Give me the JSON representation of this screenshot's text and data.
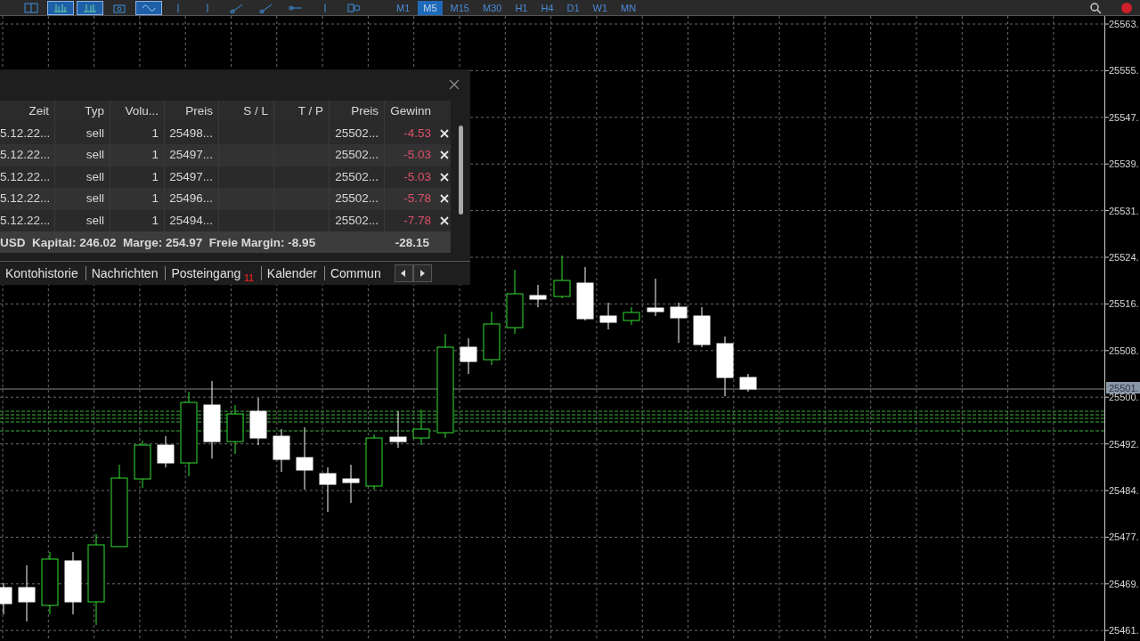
{
  "toolbar": {
    "tools": [
      {
        "kind": "layout",
        "selected": false
      },
      {
        "kind": "bars",
        "selected": true
      },
      {
        "kind": "candles",
        "selected": true
      },
      {
        "kind": "camera",
        "selected": false
      },
      {
        "kind": "wave",
        "selected": true
      },
      {
        "kind": "vline",
        "selected": false
      },
      {
        "kind": "vline",
        "selected": false
      },
      {
        "kind": "trend",
        "selected": false
      },
      {
        "kind": "trend",
        "selected": false
      },
      {
        "kind": "hline",
        "selected": false
      },
      {
        "kind": "vline",
        "selected": false
      },
      {
        "kind": "shapes",
        "selected": false
      }
    ],
    "timeframes": [
      {
        "label": "M1",
        "selected": false
      },
      {
        "label": "M5",
        "selected": true
      },
      {
        "label": "M15",
        "selected": false
      },
      {
        "label": "M30",
        "selected": false
      },
      {
        "label": "H1",
        "selected": false
      },
      {
        "label": "H4",
        "selected": false
      },
      {
        "label": "D1",
        "selected": false
      },
      {
        "label": "W1",
        "selected": false
      },
      {
        "label": "MN",
        "selected": false
      }
    ]
  },
  "price_axis": {
    "ticks": [
      "25563.",
      "25555.",
      "25547.",
      "25539.",
      "25531.",
      "25524.",
      "25516.",
      "25508.",
      "25500.",
      "25492.",
      "25484.",
      "25477.",
      "25469.",
      "25461."
    ],
    "current_price": "25501."
  },
  "trade_panel": {
    "columns": [
      "Zeit",
      "Typ",
      "Volu...",
      "Preis",
      "S / L",
      "T / P",
      "Preis",
      "Gewinn"
    ],
    "rows": [
      {
        "time": "5.12.22...",
        "type": "sell",
        "volume": "1",
        "open_price": "25498...",
        "price": "25502...",
        "profit": "-4.53"
      },
      {
        "time": "5.12.22...",
        "type": "sell",
        "volume": "1",
        "open_price": "25497...",
        "price": "25502...",
        "profit": "-5.03"
      },
      {
        "time": "5.12.22...",
        "type": "sell",
        "volume": "1",
        "open_price": "25497...",
        "price": "25502...",
        "profit": "-5.03"
      },
      {
        "time": "5.12.22...",
        "type": "sell",
        "volume": "1",
        "open_price": "25496...",
        "price": "25502...",
        "profit": "-5.78"
      },
      {
        "time": "5.12.22...",
        "type": "sell",
        "volume": "1",
        "open_price": "25494...",
        "price": "25502...",
        "profit": "-7.78"
      }
    ],
    "summary": {
      "text": "USD  Kapital: 246.02  Marge: 254.97  Freie Margin: -8.95",
      "total": "-28.15"
    },
    "tabs": [
      {
        "label": "Kontohistorie"
      },
      {
        "label": "Nachrichten"
      },
      {
        "label": "Posteingang",
        "badge": "11"
      },
      {
        "label": "Kalender"
      },
      {
        "label": "Commun"
      }
    ]
  }
}
